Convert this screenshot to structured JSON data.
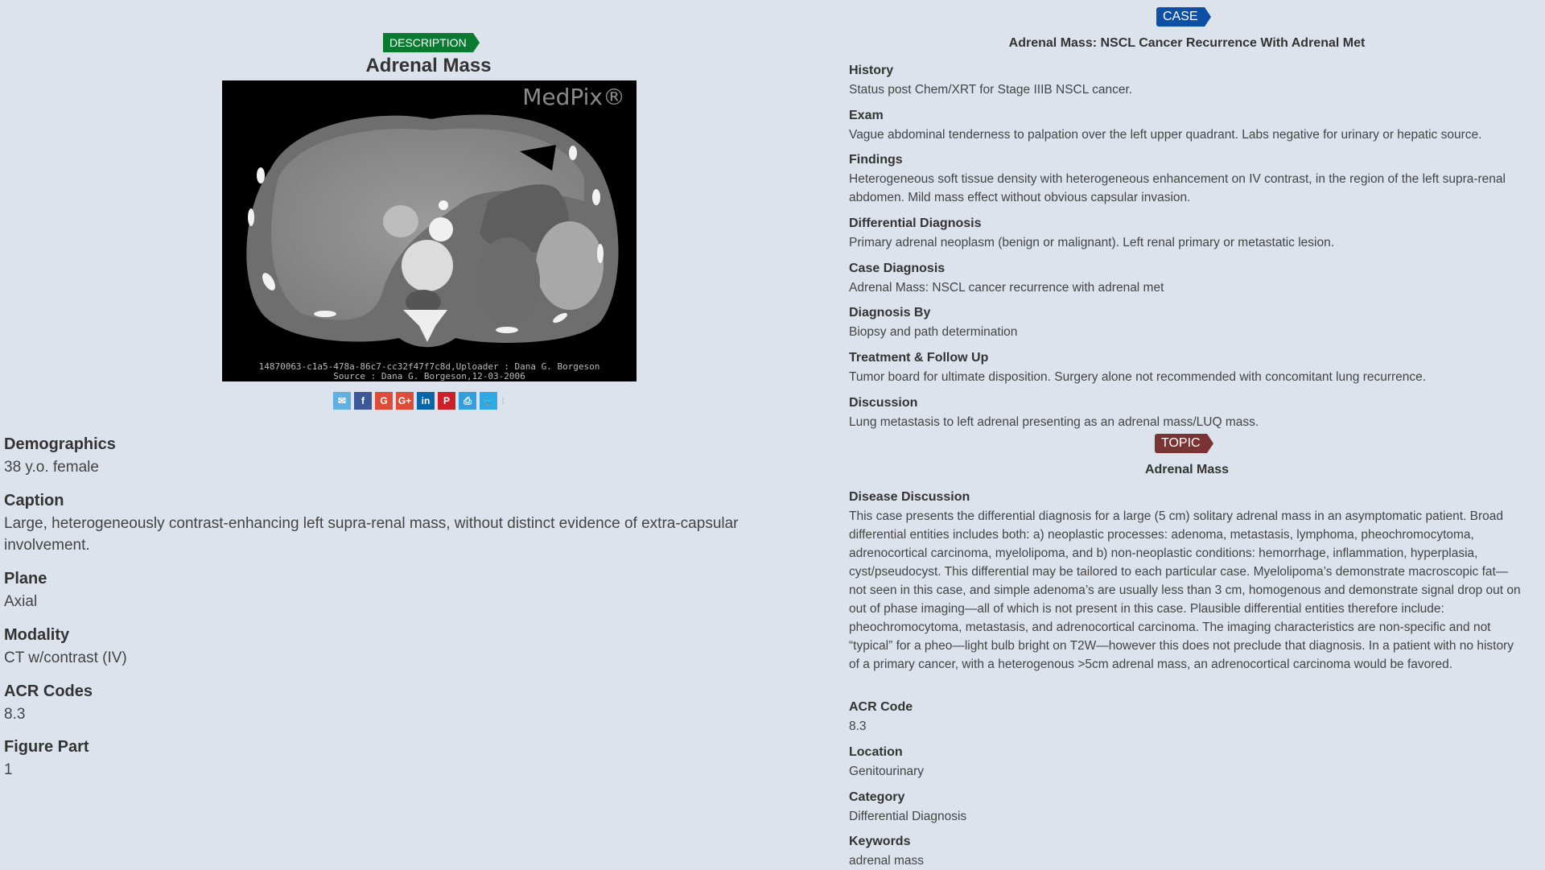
{
  "description": {
    "badge": "DESCRIPTION",
    "title": "Adrenal Mass",
    "image": {
      "watermark": "MedPix®",
      "meta_line1": "14870063-c1a5-478a-86c7-cc32f47f7c8d,Uploader : Dana G. Borgeson",
      "meta_line2": "Source : Dana G. Borgeson,12-03-2006"
    },
    "share_icons": [
      {
        "name": "email",
        "glyph": "✉"
      },
      {
        "name": "facebook",
        "glyph": "f"
      },
      {
        "name": "google",
        "glyph": "G"
      },
      {
        "name": "google-plus",
        "glyph": "G+"
      },
      {
        "name": "linkedin",
        "glyph": "in"
      },
      {
        "name": "pinterest",
        "glyph": "P"
      },
      {
        "name": "print",
        "glyph": "⎙"
      },
      {
        "name": "twitter",
        "glyph": "🐦"
      }
    ],
    "fields": [
      {
        "label": "Demographics",
        "value": "38 y.o. female"
      },
      {
        "label": "Caption",
        "value": "Large, heterogeneously contrast-enhancing left supra-renal mass, without distinct evidence of extra-capsular involvement."
      },
      {
        "label": "Plane",
        "value": "Axial"
      },
      {
        "label": "Modality",
        "value": "CT w/contrast (IV)"
      },
      {
        "label": "ACR Codes",
        "value": "8.3"
      },
      {
        "label": "Figure Part",
        "value": "1"
      }
    ]
  },
  "case": {
    "badge": "CASE",
    "title": "Adrenal Mass: NSCL Cancer Recurrence With Adrenal Met",
    "fields": [
      {
        "label": "History",
        "value": "Status post Chem/XRT for Stage IIIB NSCL cancer."
      },
      {
        "label": "Exam",
        "value": "Vague abdominal tenderness to palpation over the left upper quadrant. Labs negative for urinary or hepatic source."
      },
      {
        "label": "Findings",
        "value": "Heterogeneous soft tissue density with heterogeneous enhancement on IV contrast, in the region of the left supra-renal abdomen. Mild mass effect without obvious capsular invasion."
      },
      {
        "label": "Differential Diagnosis",
        "value": "Primary adrenal neoplasm (benign or malignant). Left renal primary or metastatic lesion."
      },
      {
        "label": "Case Diagnosis",
        "value": "Adrenal Mass: NSCL cancer recurrence with adrenal met"
      },
      {
        "label": "Diagnosis By",
        "value": "Biopsy and path determination"
      },
      {
        "label": "Treatment & Follow Up",
        "value": "Tumor board for ultimate disposition. Surgery alone not recommended with concomitant lung recurrence."
      },
      {
        "label": "Discussion",
        "value": "Lung metastasis to left adrenal presenting as an adrenal mass/LUQ mass."
      }
    ]
  },
  "topic": {
    "badge": "TOPIC",
    "title": "Adrenal Mass",
    "fields": [
      {
        "label": "Disease Discussion",
        "value": "This case presents the differential diagnosis for a large (5 cm) solitary adrenal mass in an asymptomatic patient. Broad differential entities includes both: a) neoplastic processes: adenoma, metastasis, lymphoma, pheochromocytoma, adrenocortical carcinoma, myelolipoma, and b) non-neoplastic conditions: hemorrhage, inflammation, hyperplasia, cyst/pseudocyst. This differential may be tailored to each particular case. Myelolipoma’s demonstrate macroscopic fat—not seen in this case, and simple adenoma’s are usually less than 3 cm, homogenous and demonstrate signal drop out on out of phase imaging—all of which is not present in this case. Plausible differential entities therefore include: pheochromocytoma, metastasis, and adrenocortical carcinoma. The imaging characteristics are non-specific and not “typical” for a pheo—light bulb bright on T2W—however this does not preclude that diagnosis. In a patient with no history of a primary cancer, with a heterogenous >5cm adrenal mass, an adrenocortical carcinoma would be favored."
      },
      {
        "label": "ACR Code",
        "value": "8.3"
      },
      {
        "label": "Location",
        "value": "Genitourinary"
      },
      {
        "label": "Category",
        "value": "Differential Diagnosis"
      },
      {
        "label": "Keywords",
        "value": "adrenal mass"
      }
    ]
  },
  "colors": {
    "background": "#dce3ed",
    "description_badge": "#0b7a31",
    "case_badge": "#0e4fa6",
    "topic_badge": "#7a3434"
  }
}
